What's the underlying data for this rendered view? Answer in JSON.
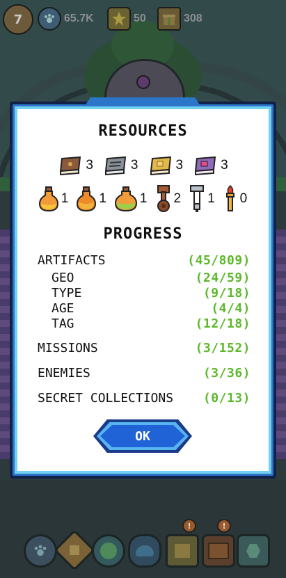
{
  "hud": {
    "level": "7",
    "paw_count": "65.7K",
    "star_count": "50",
    "box_count": "308"
  },
  "dialog": {
    "resources_title": "RESOURCES",
    "books": [
      {
        "icon": "brown-book-icon",
        "color": "#8b5a3c",
        "count": "3"
      },
      {
        "icon": "gray-book-icon",
        "color": "#8a9098",
        "count": "3"
      },
      {
        "icon": "gold-book-icon",
        "color": "#e2b84a",
        "count": "3"
      },
      {
        "icon": "purple-book-icon",
        "color": "#8e6ab8",
        "count": "3"
      }
    ],
    "items": [
      {
        "icon": "orange-potion-small-icon",
        "count": "1"
      },
      {
        "icon": "orange-potion-medium-icon",
        "count": "1"
      },
      {
        "icon": "green-potion-large-icon",
        "count": "1"
      },
      {
        "icon": "bronze-key-icon",
        "count": "2"
      },
      {
        "icon": "silver-key-icon",
        "count": "1"
      },
      {
        "icon": "fire-torch-icon",
        "count": "0"
      }
    ],
    "progress_title": "PROGRESS",
    "progress": [
      {
        "label": "ARTIFACTS",
        "value": "(45/809)"
      },
      {
        "label": "GEO",
        "value": "(24/59)"
      },
      {
        "label": "TYPE",
        "value": "(9/18)"
      },
      {
        "label": "AGE",
        "value": "(4/4)"
      },
      {
        "label": "TAG",
        "value": "(12/18)"
      },
      {
        "label": "MISSIONS",
        "value": "(3/152)"
      },
      {
        "label": "ENEMIES",
        "value": "(3/36)"
      },
      {
        "label": "SECRET COLLECTIONS",
        "value": "(0/13)"
      }
    ],
    "ok_label": "OK"
  },
  "colors": {
    "accent_green": "#5cb82a",
    "dialog_blue": "#2b76c8",
    "button_blue": "#1f63d6"
  }
}
